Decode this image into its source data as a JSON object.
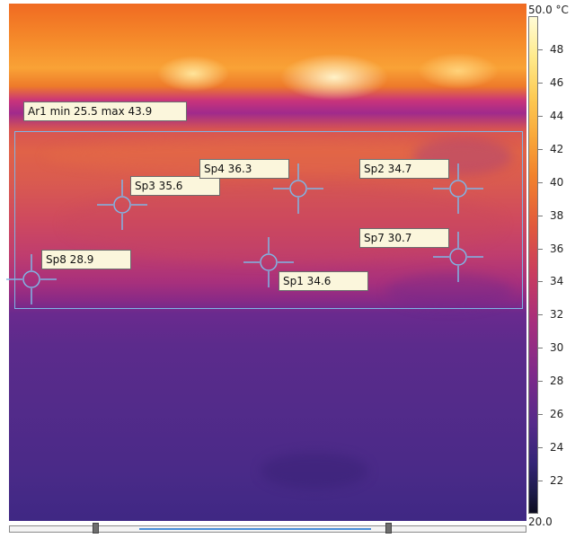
{
  "area": {
    "label": "Ar1 min 25.5 max 43.9"
  },
  "spots": [
    {
      "id": "sp1",
      "label": "Sp1 34.6"
    },
    {
      "id": "sp2",
      "label": "Sp2 34.7"
    },
    {
      "id": "sp3",
      "label": "Sp3 35.6"
    },
    {
      "id": "sp4",
      "label": "Sp4 36.3"
    },
    {
      "id": "sp7",
      "label": "Sp7 30.7"
    },
    {
      "id": "sp8",
      "label": "Sp8 28.9"
    }
  ],
  "scale": {
    "max_label": "50.0 °C",
    "min_label": "20.0",
    "ticks": [
      "48",
      "46",
      "44",
      "42",
      "40",
      "38",
      "36",
      "34",
      "32",
      "30",
      "28",
      "26",
      "24",
      "22"
    ]
  },
  "colors": {
    "marker": "#7fb6e6",
    "label_bg": "#fbf6dc"
  }
}
